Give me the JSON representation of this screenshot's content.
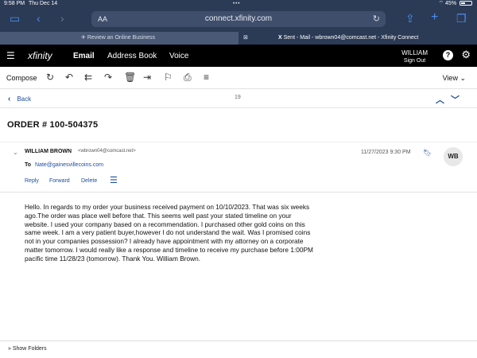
{
  "status_bar": {
    "time": "9:58 PM",
    "date": "Thu Dec 14",
    "battery": "45%",
    "battery_level": 0.45
  },
  "browser": {
    "text_size_label": "AA",
    "url": "connect.xfinity.com",
    "tabs": [
      {
        "label": "Review an Online Business"
      },
      {
        "label": "Sent - Mail - wbrown04@comcast.net - Xfinity Connect"
      }
    ],
    "accent_color": "#4b8ef0"
  },
  "app_header": {
    "logo": "xfinity",
    "nav": [
      "Email",
      "Address Book",
      "Voice"
    ],
    "user_name": "WILLIAM",
    "sign_out": "Sign Out",
    "help_label": "?"
  },
  "toolbar": {
    "compose_label": "Compose",
    "view_label": "View",
    "icons": [
      "refresh-icon",
      "reply-icon",
      "reply-all-icon",
      "forward-icon",
      "delete-icon",
      "move-icon",
      "mark-icon",
      "flag-icon",
      "print-icon",
      "more-icon"
    ]
  },
  "nav_row": {
    "back_label": "Back",
    "message_count": "19"
  },
  "message": {
    "subject": "ORDER # 100-504375",
    "sender_name": "WILLIAM BROWN",
    "sender_email": "<wbrown04@comcast.net>",
    "to_label": "To",
    "to_email": "Nate@gainesvillecoins.com",
    "actions": [
      "Reply",
      "Forward",
      "Delete"
    ],
    "date": "11/27/2023 9:30 PM",
    "avatar_initials": "WB",
    "body_lines": [
      "Hello. In regards to my order your business received payment on 10/10/2023. That was six weeks",
      "ago.The order was place well before that. This seems well past your stated timeline on your",
      "website. I used your company based on a recommendation. I purchased other gold coins on this",
      "same week. I am a very patient buyer,however I do not understand the wait. Was I promised coins",
      "not in your companies possession? I already have appointment with my attorney on a corporate",
      "matter tomorrow. I would really like a response and timeline to receive my purchase before 1:00PM",
      "pacific time 11/28/23 (tomorrow). Thank You. William Brown."
    ]
  },
  "footer": {
    "show_folders": "Show Folders"
  }
}
